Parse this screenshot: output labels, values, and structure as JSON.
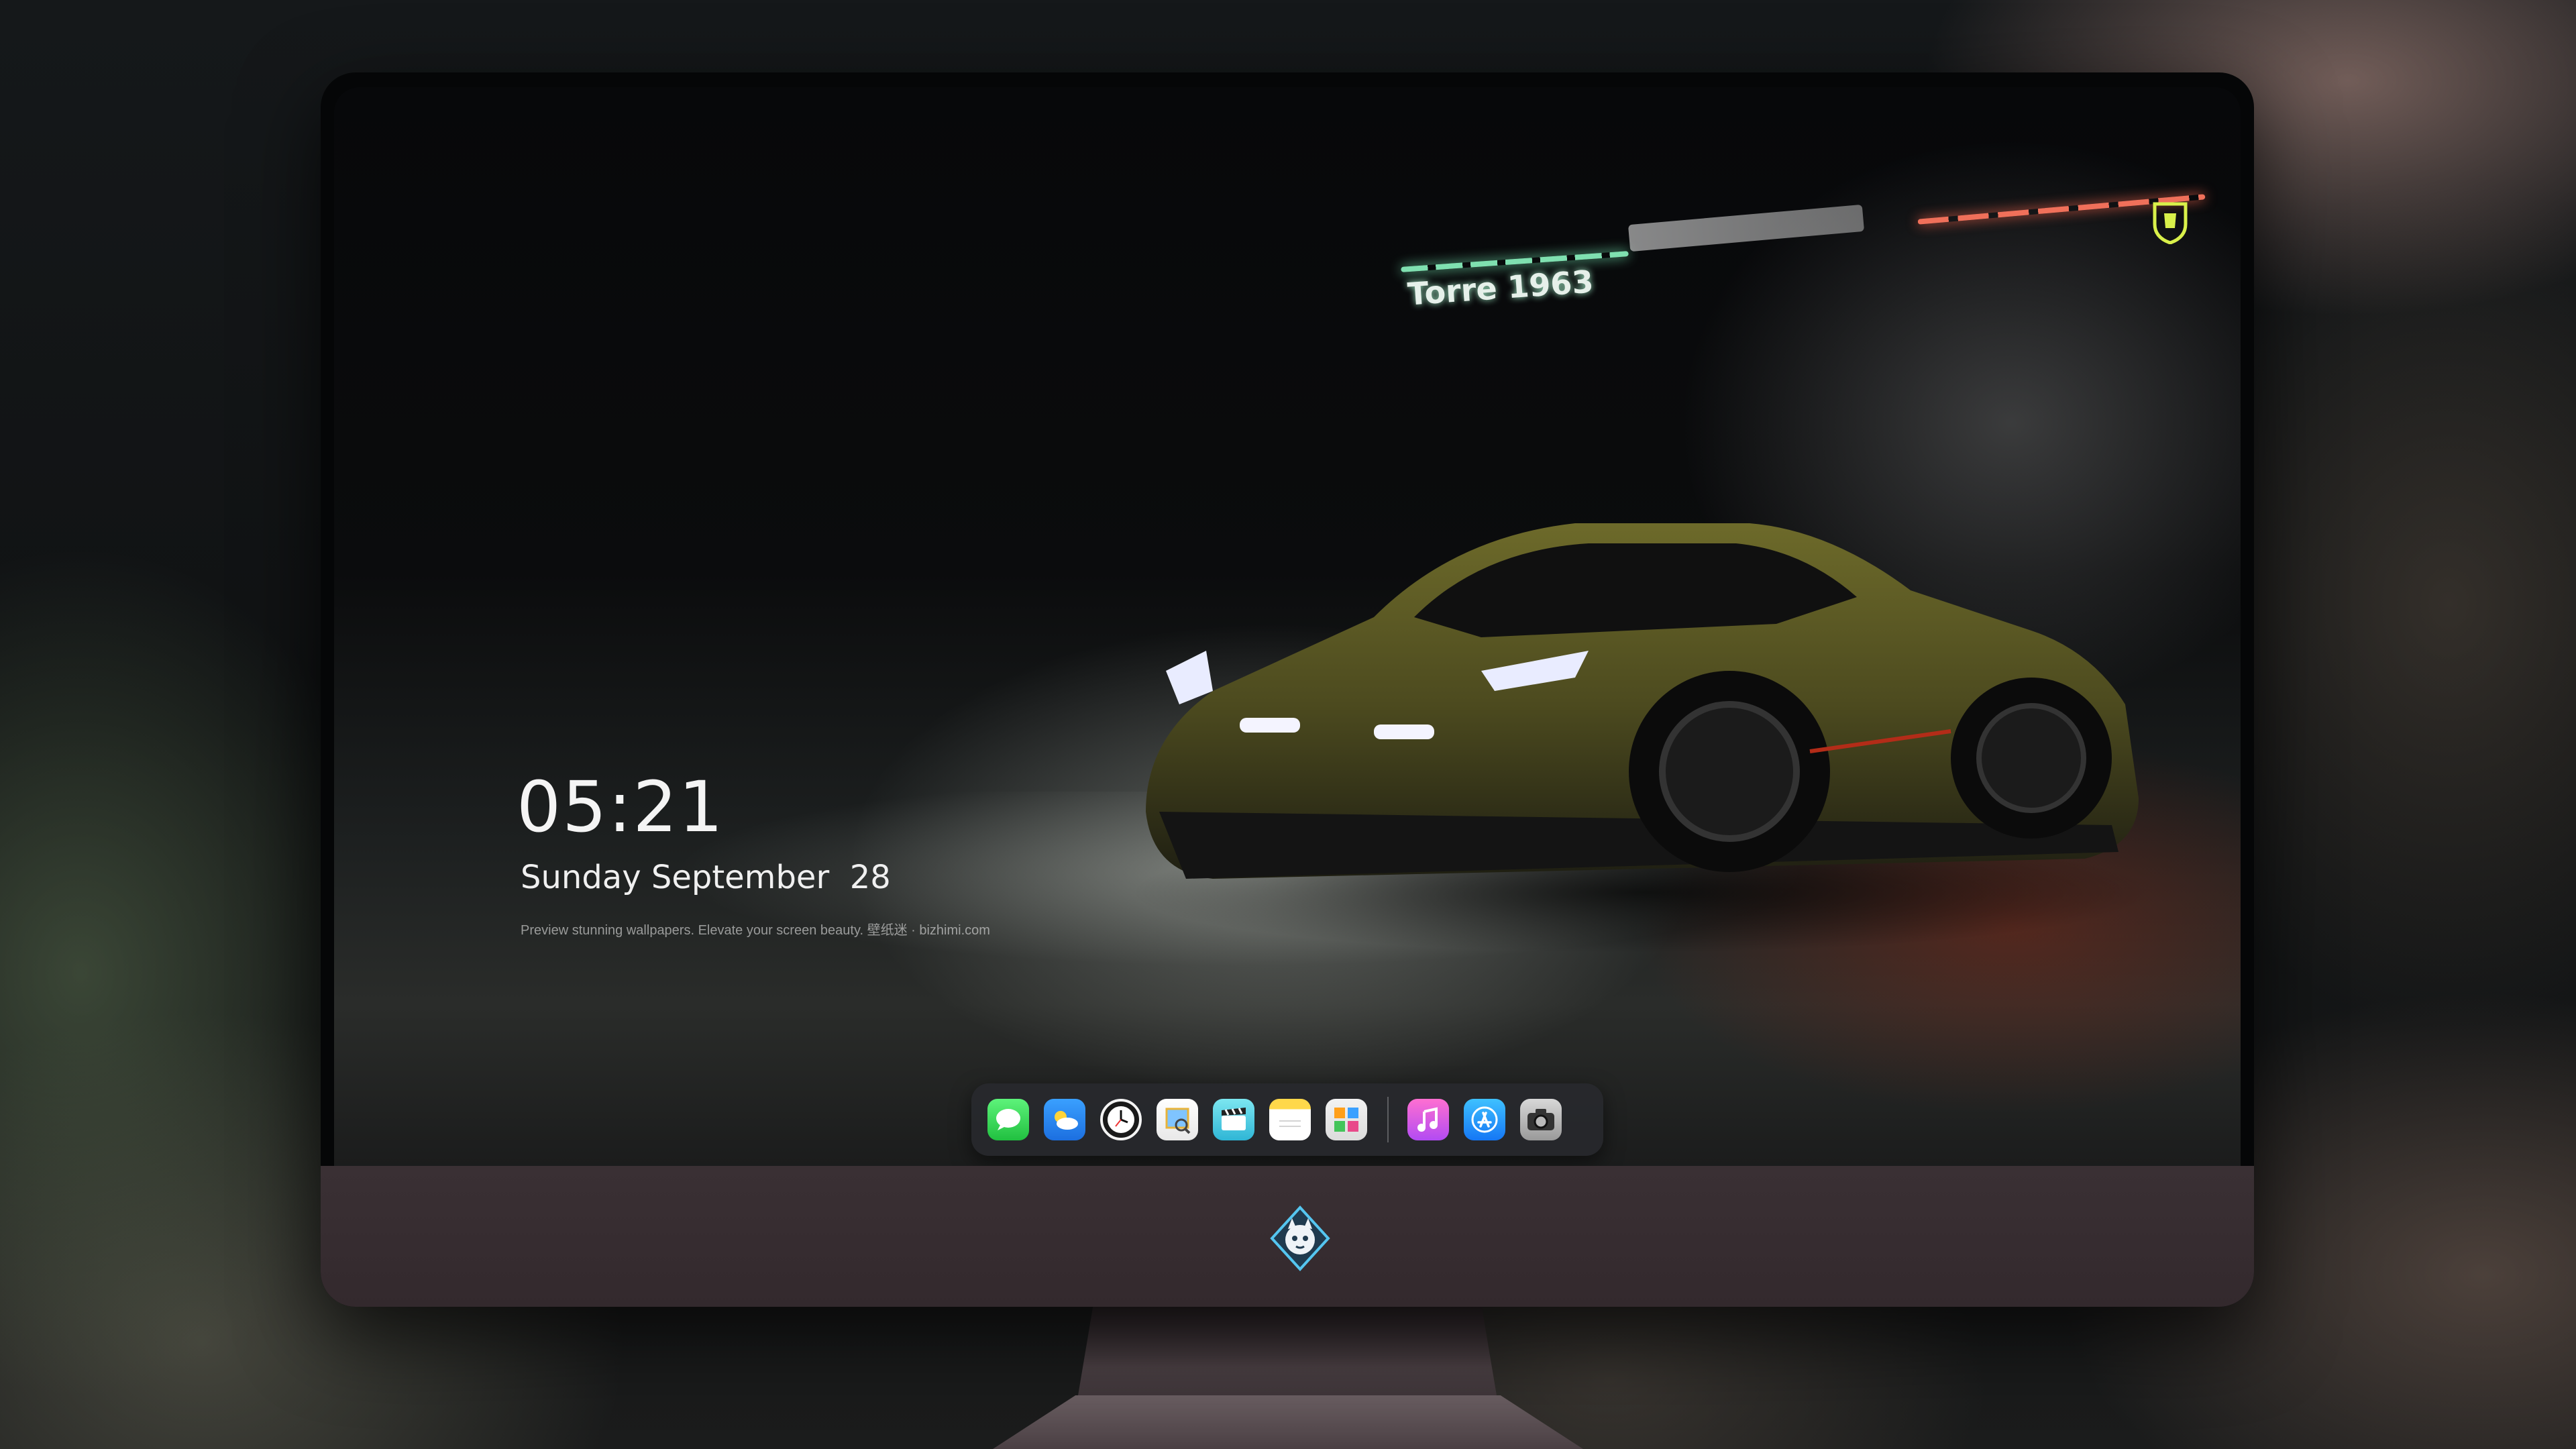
{
  "lock_screen": {
    "time": "05:21",
    "date": "Sunday September  28",
    "tagline": "Preview stunning wallpapers. Elevate your screen beauty. 壁纸迷 · bizhimi.com"
  },
  "wallpaper": {
    "neon_sign": "Torre 1963"
  },
  "dock": {
    "apps": [
      {
        "name": "Messages",
        "icon": "messages-icon"
      },
      {
        "name": "Weather",
        "icon": "weather-icon"
      },
      {
        "name": "Clock",
        "icon": "clock-icon"
      },
      {
        "name": "Preview",
        "icon": "preview-icon"
      },
      {
        "name": "Clips",
        "icon": "clips-icon"
      },
      {
        "name": "Notes",
        "icon": "notes-icon"
      },
      {
        "name": "Photos",
        "icon": "photos-icon"
      },
      {
        "name": "Music",
        "icon": "music-icon"
      },
      {
        "name": "App Store",
        "icon": "app-store-icon"
      },
      {
        "name": "Camera",
        "icon": "camera-icon"
      }
    ]
  },
  "colors": {
    "monitor_chin": "#3a3034",
    "dock_bg": "#282a2e",
    "text": "#f4f4f4"
  }
}
